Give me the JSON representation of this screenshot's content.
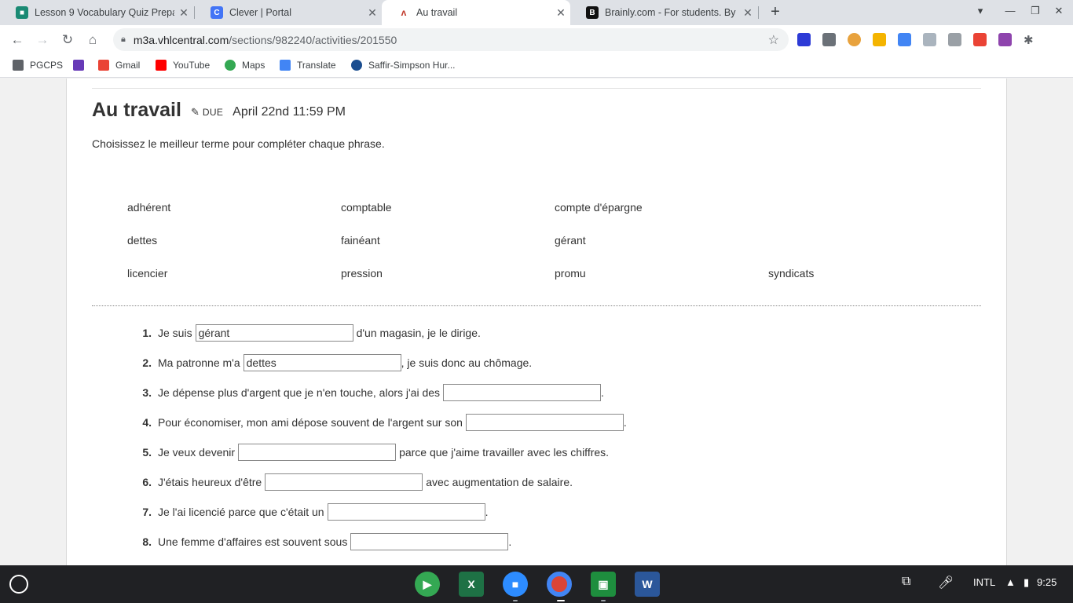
{
  "browser": {
    "tabs": [
      {
        "title": "Lesson 9 Vocabulary Quiz Prepa",
        "icon": "classroom-icon",
        "color": "#1a8a74"
      },
      {
        "title": "Clever | Portal",
        "icon": "clever-icon",
        "color": "#4274f6"
      },
      {
        "title": "Au travail",
        "icon": "vhl-icon",
        "color": "#c0392b"
      },
      {
        "title": "Brainly.com - For students. By st",
        "icon": "brainly-icon",
        "color": "#111111"
      }
    ],
    "active_tab": 2,
    "url_host": "m3a.vhlcentral.com",
    "url_path": "/sections/982240/activities/201550",
    "bookmarks": [
      {
        "label": "PGCPS",
        "icon": "folder-icon"
      },
      {
        "label": "",
        "icon": "apps-icon"
      },
      {
        "label": "Gmail",
        "icon": "gmail-icon"
      },
      {
        "label": "YouTube",
        "icon": "youtube-icon"
      },
      {
        "label": "Maps",
        "icon": "maps-icon"
      },
      {
        "label": "Translate",
        "icon": "translate-icon"
      },
      {
        "label": "Saffir-Simpson Hur...",
        "icon": "noaa-icon"
      }
    ]
  },
  "activity": {
    "title": "Au travail",
    "due_label": "DUE",
    "due_date": "April 22nd 11:59 PM",
    "instruction": "Choisissez le meilleur terme pour compléter chaque phrase.",
    "word_bank": [
      "adhérent",
      "comptable",
      "compte d'épargne",
      "dettes",
      "fainéant",
      "gérant",
      "licencier",
      "pression",
      "promu",
      "syndicats"
    ],
    "questions": [
      {
        "num": "1.",
        "before": "Je suis",
        "answer": "gérant",
        "after": "d'un magasin, je le dirige."
      },
      {
        "num": "2.",
        "before": "Ma patronne m'a",
        "answer": "dettes",
        "after": ", je suis donc au chômage."
      },
      {
        "num": "3.",
        "before": "Je dépense plus d'argent que je n'en touche, alors j'ai des",
        "answer": "",
        "after": "."
      },
      {
        "num": "4.",
        "before": "Pour économiser, mon ami dépose souvent de l'argent sur son",
        "answer": "",
        "after": "."
      },
      {
        "num": "5.",
        "before": "Je veux devenir",
        "answer": "",
        "after": "parce que j'aime travailler avec les chiffres."
      },
      {
        "num": "6.",
        "before": "J'étais heureux d'être",
        "answer": "",
        "after": "avec augmentation de salaire."
      },
      {
        "num": "7.",
        "before": "Je l'ai licencié parce que c'était un",
        "answer": "",
        "after": "."
      },
      {
        "num": "8.",
        "before": "Une femme d'affaires est souvent sous",
        "answer": "",
        "after": "."
      }
    ]
  },
  "system": {
    "keyboard": "INTL",
    "time": "9:25"
  }
}
